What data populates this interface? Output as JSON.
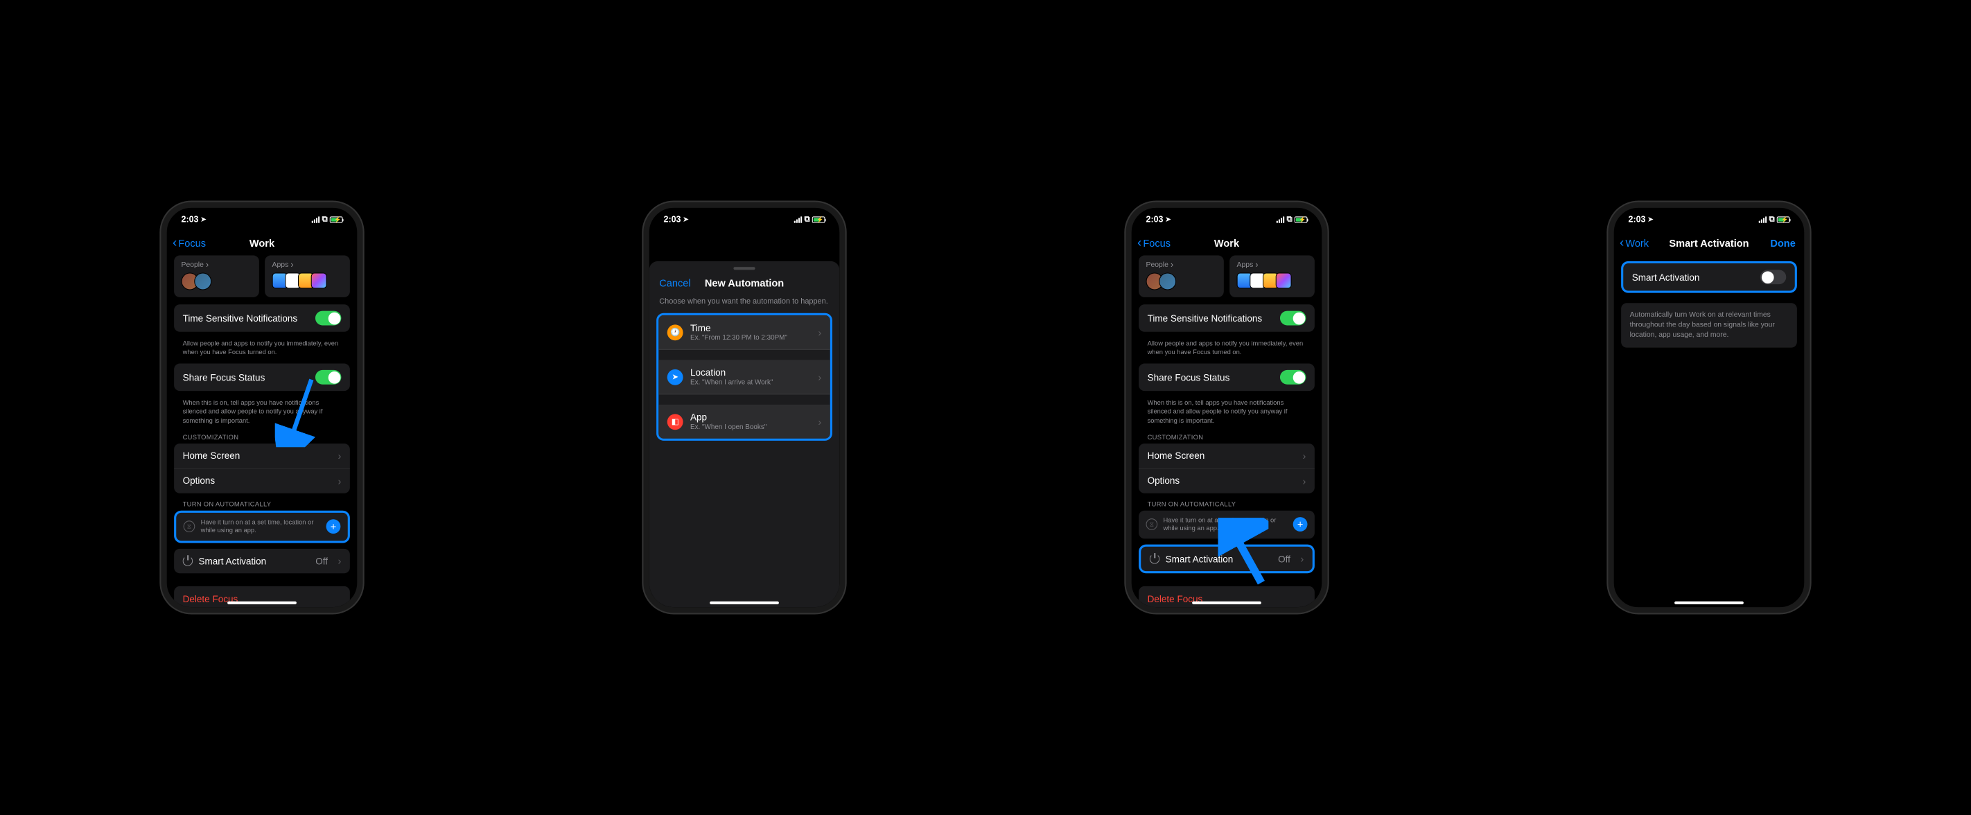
{
  "status": {
    "time": "2:03",
    "nav": "➤"
  },
  "p1": {
    "back": "Focus",
    "title": "Work",
    "people": "People",
    "apps": "Apps",
    "tsn": "Time Sensitive Notifications",
    "tsn_footer": "Allow people and apps to notify you immediately, even when you have Focus turned on.",
    "share": "Share Focus Status",
    "share_footer": "When this is on, tell apps you have notifications silenced and allow people to notify you anyway if something is important.",
    "custom": "CUSTOMIZATION",
    "home": "Home Screen",
    "options": "Options",
    "auto_header": "TURN ON AUTOMATICALLY",
    "auto_text": "Have it turn on at a set time, location or while using an app.",
    "smart": "Smart Activation",
    "smart_val": "Off",
    "delete": "Delete Focus"
  },
  "p2": {
    "cancel": "Cancel",
    "title": "New Automation",
    "sub": "Choose when you want the automation to happen.",
    "time": "Time",
    "time_ex": "Ex. \"From 12:30 PM to 2:30PM\"",
    "loc": "Location",
    "loc_ex": "Ex. \"When I arrive at Work\"",
    "app": "App",
    "app_ex": "Ex. \"When I open Books\""
  },
  "p4": {
    "back": "Work",
    "title": "Smart Activation",
    "done": "Done",
    "label": "Smart Activation",
    "footer": "Automatically turn Work on at relevant times throughout the day based on signals like your location, app usage, and more."
  }
}
